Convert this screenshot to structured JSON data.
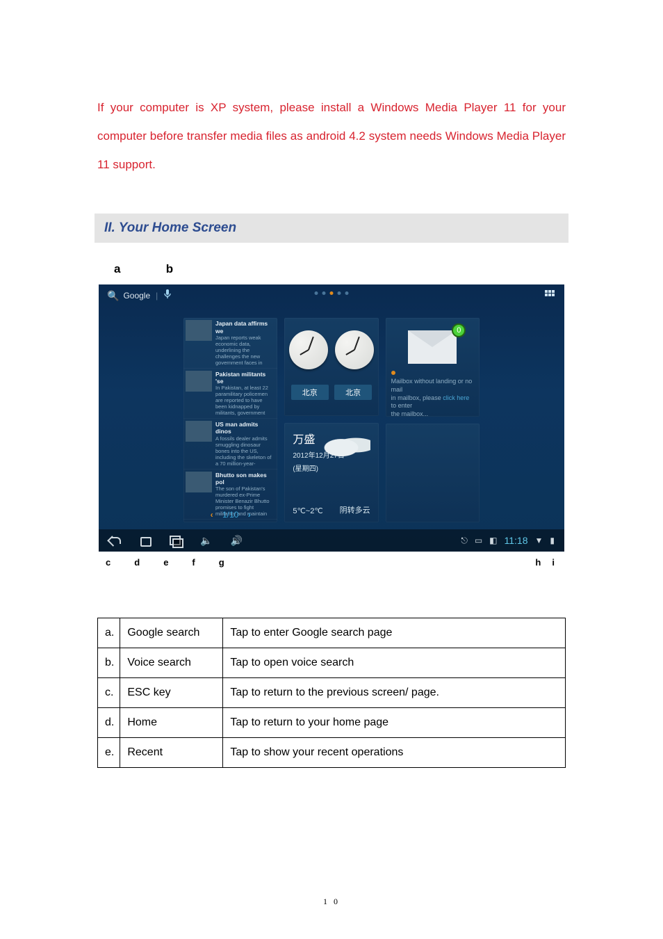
{
  "paragraph_red": "If your computer is XP system, please install a Windows Media Player 11 for your computer before transfer media files as android 4.2 system needs Windows Media Player 11 support.",
  "section_header": "II. Your Home Screen",
  "labels_above": {
    "a": "a",
    "b": "b"
  },
  "labels_below_left": [
    "c",
    "d",
    "e",
    "f",
    "g"
  ],
  "labels_below_right": [
    "h",
    "i"
  ],
  "android": {
    "topbar": {
      "search_label": "Google",
      "pager_active_index": 2
    },
    "news": {
      "items": [
        {
          "title": "Japan data affirms we",
          "desc": "Japan reports weak economic data, underlining the challenges the new government faces in"
        },
        {
          "title": "Pakistan militants 'se",
          "desc": "In Pakistan, at least 22 paramilitary policemen are reported to have been kidnapped by militants, government"
        },
        {
          "title": "US man admits dinos",
          "desc": "A fossils dealer admits smuggling dinosaur bones into the US, including the skeleton of a 70 million-year-"
        },
        {
          "title": "Bhutto son makes pol",
          "desc": "The son of Pakistan's murdered ex-Prime Minister Benazir Bhutto promises to fight militancy and maintain"
        }
      ],
      "page_indicator": "1/10"
    },
    "clocks": {
      "city_left": "北京",
      "city_right": "北京"
    },
    "mail": {
      "badge": "0",
      "line1": "Mailbox without landing or no mail",
      "line2a": "in mailbox, please ",
      "line2_link": "click here",
      "line2b": " to enter",
      "line3": "the mailbox..."
    },
    "weather": {
      "city": "万盛",
      "date_line1": "2012年12月27日",
      "date_line2": "(星期四)",
      "temp": "5℃~2℃",
      "condition": "阴转多云"
    },
    "navbar": {
      "time": "11:18"
    }
  },
  "table_rows": [
    {
      "idx": "a.",
      "name": "Google search",
      "desc": "Tap to enter Google search page"
    },
    {
      "idx": "b.",
      "name": "Voice search",
      "desc": "Tap to open voice search"
    },
    {
      "idx": "c.",
      "name": "ESC key",
      "desc": "Tap to return to the previous screen/ page."
    },
    {
      "idx": "d.",
      "name": "Home",
      "desc": "Tap to return to your home page"
    },
    {
      "idx": "e.",
      "name": "Recent",
      "desc": "Tap to show your recent operations"
    }
  ],
  "page_number": "1 0"
}
